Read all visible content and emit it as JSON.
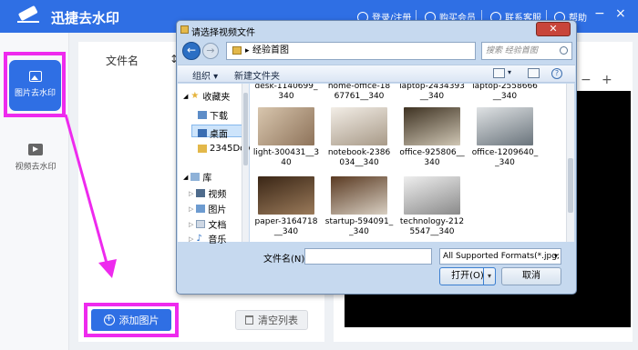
{
  "app": {
    "title": "迅捷去水印",
    "header_links": {
      "login": "登录/注册",
      "vip": "购买会员",
      "support": "联系客服",
      "help": "帮助"
    },
    "window_controls": {
      "minimize": "−",
      "close": "×"
    },
    "accent_color": "#2f6fe4",
    "highlight_color": "#ee2aee"
  },
  "sidebar": {
    "items": [
      {
        "label": "图片去水印",
        "icon": "image-icon",
        "active": true
      },
      {
        "label": "视频去水印",
        "icon": "video-icon",
        "active": false
      }
    ]
  },
  "main": {
    "column_header": "文件名",
    "column_header_2": "↕",
    "add_button": "添加图片",
    "clear_button": "清空列表"
  },
  "preview": {
    "zoom_out": "−",
    "zoom_in": "+"
  },
  "dialog": {
    "title": "请选择视频文件",
    "close_label": "✕",
    "address": "经验首图",
    "search_placeholder": "搜索 经验首图",
    "toolbar": {
      "organize": "组织 ▾",
      "new_folder": "新建文件夹"
    },
    "nav": [
      {
        "label": "收藏夹",
        "icon": "star-icon"
      },
      {
        "label": "下载",
        "icon": "download-icon"
      },
      {
        "label": "桌面",
        "icon": "desktop-icon",
        "selected": true
      },
      {
        "label": "2345Dov",
        "icon": "folder-icon"
      },
      {
        "label": "库",
        "icon": "library-icon"
      },
      {
        "label": "视频",
        "icon": "video-lib-icon"
      },
      {
        "label": "图片",
        "icon": "picture-lib-icon"
      },
      {
        "label": "文档",
        "icon": "document-lib-icon"
      },
      {
        "label": "音乐",
        "icon": "music-lib-icon"
      }
    ],
    "files_top_row": [
      {
        "name": "desk-1140699_\n340"
      },
      {
        "name": "home-office-18\n67761__340"
      },
      {
        "name": "laptop-2434393\n__340"
      },
      {
        "name": "laptop-2558666\n__340"
      }
    ],
    "files": [
      {
        "name": "light-300431__3\n40",
        "color1": "#c9b39a",
        "color2": "#8e735a"
      },
      {
        "name": "notebook-2386\n034__340",
        "color1": "#e8e2d8",
        "color2": "#a89a88"
      },
      {
        "name": "office-925806__\n340",
        "color1": "#5a4a32",
        "color2": "#cfc6b4"
      },
      {
        "name": "office-1209640_\n_340",
        "color1": "#bfc4c8",
        "color2": "#6a747c"
      },
      {
        "name": "paper-3164718\n__340",
        "color1": "#4a3424",
        "color2": "#9a7a5a"
      },
      {
        "name": "startup-594091_\n_340",
        "color1": "#6b4a30",
        "color2": "#d8cfc2"
      },
      {
        "name": "technology-212\n5547__340",
        "color1": "#dedede",
        "color2": "#8a8a8a"
      }
    ],
    "filename_label": "文件名(N):",
    "filename_value": "",
    "filetype": "All Supported Formats(*.jpg;",
    "open_button": "打开(O)",
    "cancel_button": "取消"
  }
}
